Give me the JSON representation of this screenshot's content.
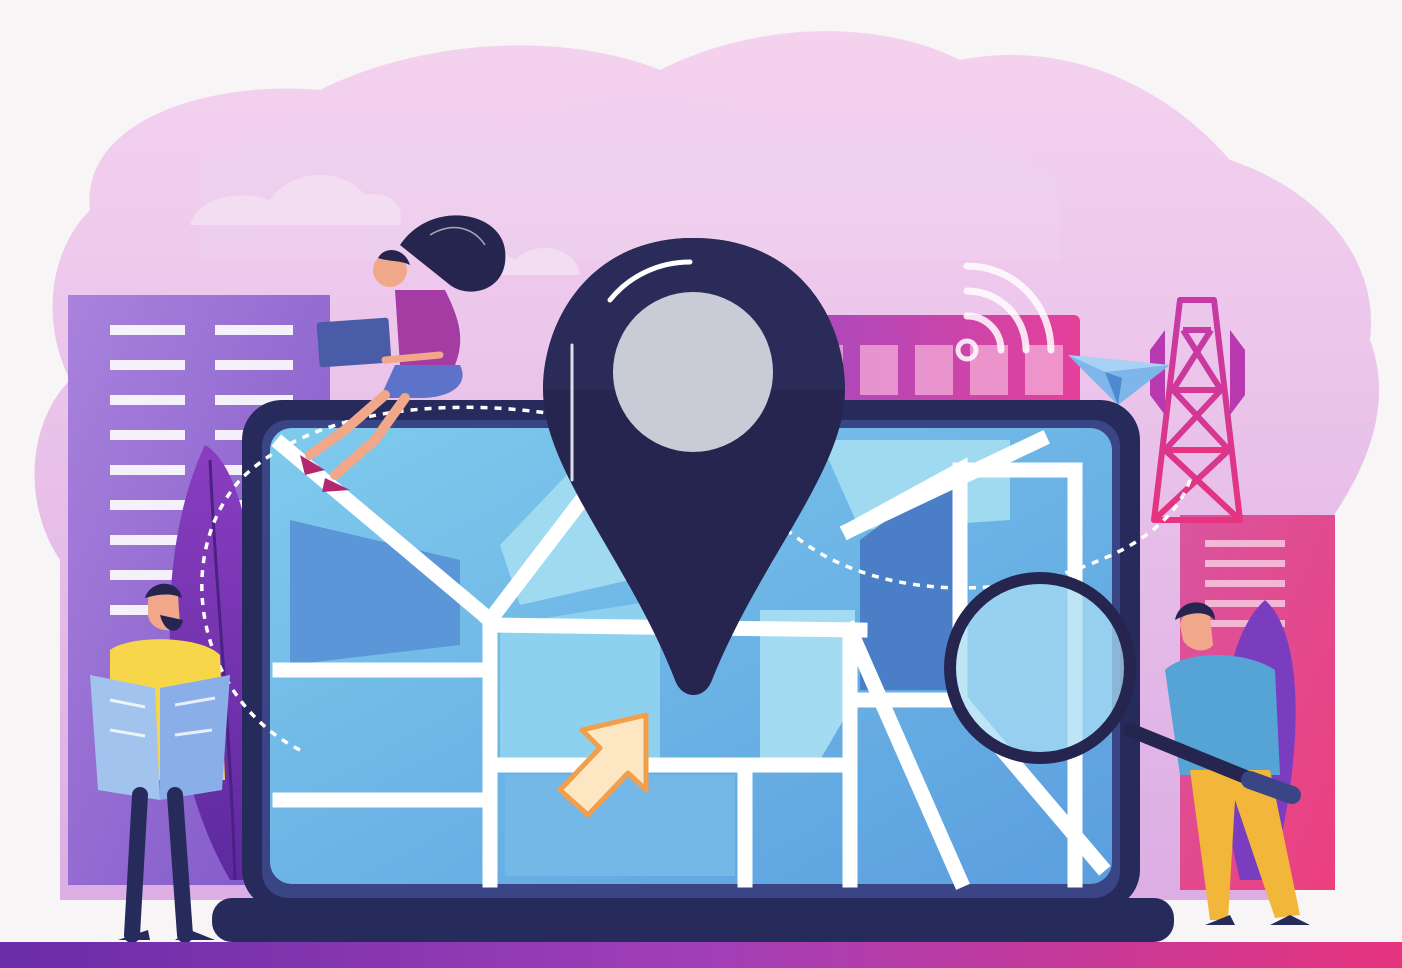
{
  "illustration": {
    "subject": "location-search-map-illustration",
    "palette": {
      "background": "#f7f5f6",
      "blob_light": "#f2c9e8",
      "blob_mid": "#dca7e2",
      "building_purple": "#9b6fd1",
      "building_pink": "#e33d8e",
      "laptop_frame": "#262b5c",
      "laptop_bezel": "#3a4585",
      "map_light": "#8fd3ee",
      "map_mid": "#5fa3dc",
      "map_dark": "#3b6fbf",
      "pin": "#25254f",
      "pin_center": "#c9ccd6",
      "cursor": "#fde7c3",
      "ground_left": "#6a2ca8",
      "ground_right": "#e6347e"
    },
    "icons": [
      "map-pin-icon",
      "cursor-arrow-icon",
      "magnifier-icon",
      "wifi-signal-icon",
      "paper-plane-icon",
      "radio-tower-icon"
    ],
    "figures": [
      "woman-with-laptop",
      "man-reading-map",
      "man-with-magnifier"
    ]
  }
}
